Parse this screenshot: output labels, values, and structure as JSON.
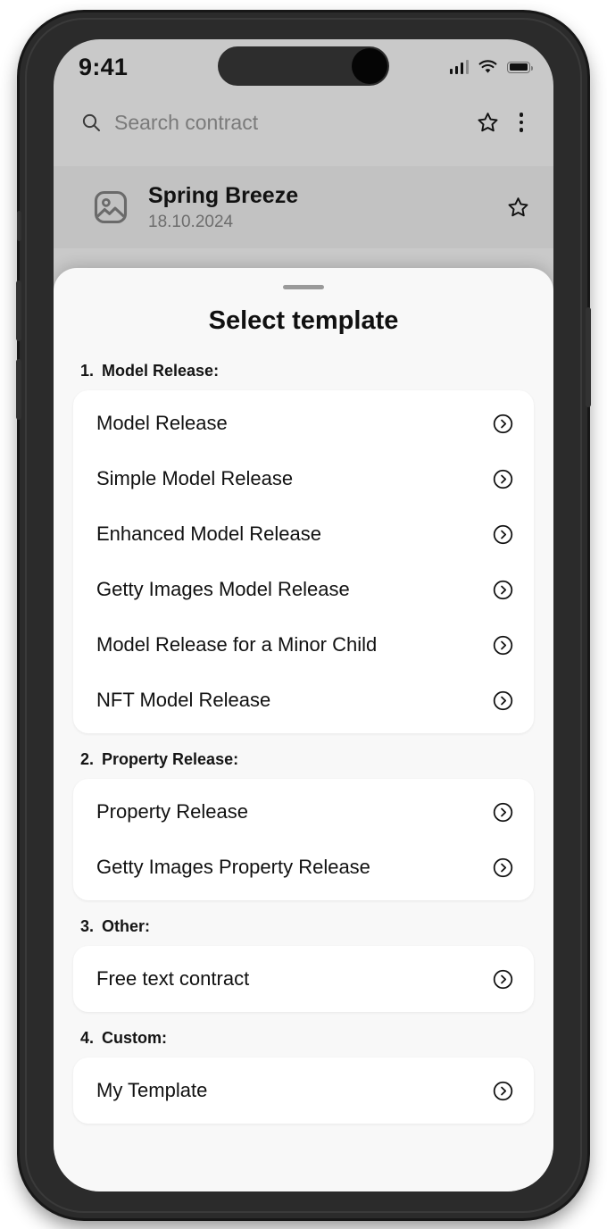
{
  "status_bar": {
    "time": "9:41",
    "cellular_icon": "signal-bars-icon",
    "wifi_icon": "wifi-icon",
    "battery_icon": "battery-full-icon"
  },
  "search": {
    "icon": "search-icon",
    "placeholder": "Search contract",
    "value": "",
    "favorite_icon": "star-outline-icon",
    "overflow_icon": "more-vertical-icon"
  },
  "background_list": {
    "rows": [
      {
        "thumb_icon": "image-placeholder-icon",
        "title": "Spring Breeze",
        "date": "18.10.2024",
        "favorite_icon": "star-outline-icon"
      }
    ]
  },
  "sheet": {
    "handle": "drag-handle",
    "title": "Select template",
    "sections": [
      {
        "number": "1.",
        "label": "Model Release:",
        "items": [
          {
            "label": "Model Release",
            "chevron_icon": "chevron-right-circle-icon"
          },
          {
            "label": "Simple Model Release",
            "chevron_icon": "chevron-right-circle-icon"
          },
          {
            "label": "Enhanced Model Release",
            "chevron_icon": "chevron-right-circle-icon"
          },
          {
            "label": "Getty Images Model Release",
            "chevron_icon": "chevron-right-circle-icon"
          },
          {
            "label": "Model Release for a Minor Child",
            "chevron_icon": "chevron-right-circle-icon"
          },
          {
            "label": "NFT Model Release",
            "chevron_icon": "chevron-right-circle-icon"
          }
        ]
      },
      {
        "number": "2.",
        "label": "Property Release:",
        "items": [
          {
            "label": "Property Release",
            "chevron_icon": "chevron-right-circle-icon"
          },
          {
            "label": "Getty Images Property Release",
            "chevron_icon": "chevron-right-circle-icon"
          }
        ]
      },
      {
        "number": "3.",
        "label": "Other:",
        "items": [
          {
            "label": "Free text contract",
            "chevron_icon": "chevron-right-circle-icon"
          }
        ]
      },
      {
        "number": "4.",
        "label": "Custom:",
        "items": [
          {
            "label": "My Template",
            "chevron_icon": "chevron-right-circle-icon"
          }
        ]
      }
    ]
  },
  "colors": {
    "backdrop": "#c9c9c9",
    "sheet_bg": "#f8f8f8",
    "card_bg": "#ffffff",
    "text_primary": "#111111",
    "text_muted": "#7a7a7a",
    "frame": "#2b2b2b"
  }
}
